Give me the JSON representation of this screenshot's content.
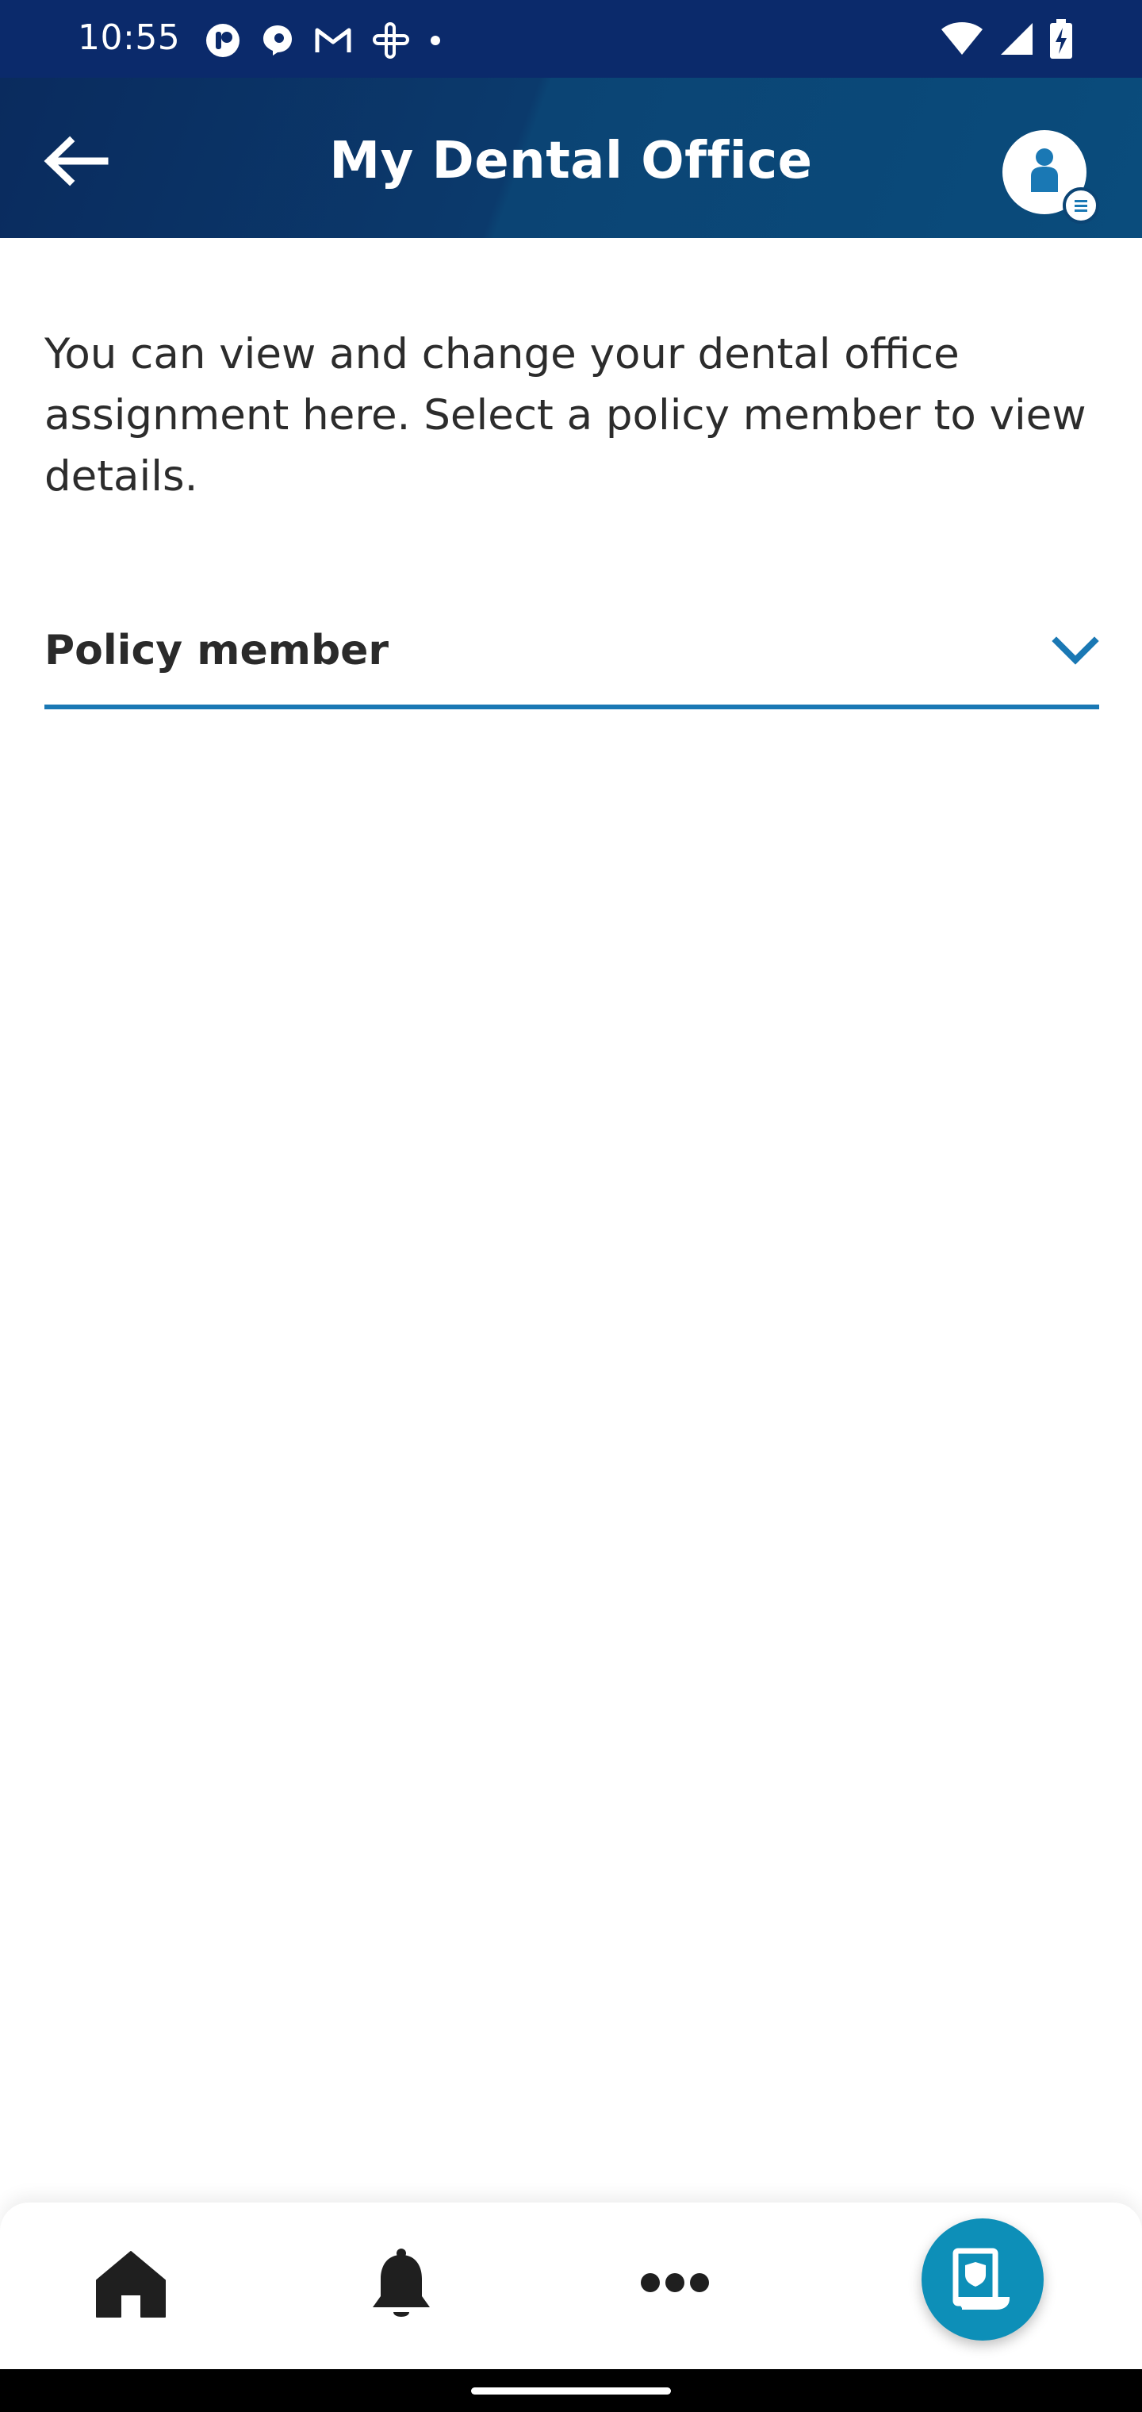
{
  "status_bar": {
    "time": "10:55",
    "left_icons": [
      "app-notification-icon",
      "chat-notification-icon",
      "gmail-icon",
      "slack-icon",
      "more-notifications-dot-icon"
    ],
    "right_icons": [
      "wifi-icon",
      "cellular-signal-icon",
      "battery-charging-icon"
    ]
  },
  "app_bar": {
    "title": "My Dental Office",
    "back_icon": "arrow-left-icon",
    "account_icon": "person-icon"
  },
  "content": {
    "description": "You can view and change your dental office assignment here. Select a policy member to view details.",
    "policy_select": {
      "label": "Policy member",
      "icon": "chevron-down-icon"
    }
  },
  "bottom_nav": {
    "items": [
      {
        "icon": "home-icon"
      },
      {
        "icon": "bell-icon"
      },
      {
        "icon": "more-horizontal-icon"
      }
    ],
    "fab_icon": "insurance-card-icon"
  },
  "colors": {
    "status_bar": "#0b2a6b",
    "app_bar": "#0b3a6c",
    "accent": "#1a78b4",
    "fab": "#0d8fb8"
  }
}
